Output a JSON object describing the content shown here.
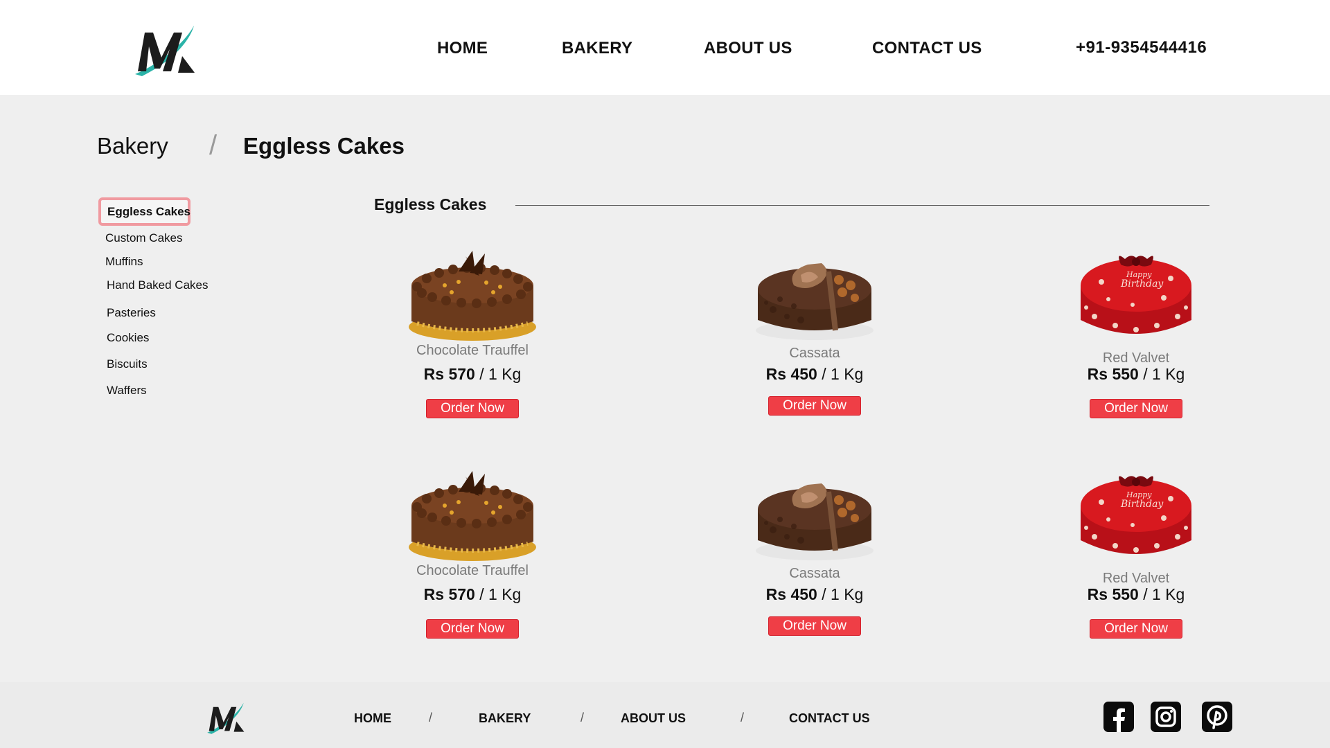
{
  "header": {
    "nav": [
      "HOME",
      "BAKERY",
      "ABOUT US",
      "CONTACT US"
    ],
    "phone": "+91-9354544416"
  },
  "breadcrumb": {
    "root": "Bakery",
    "separator": "/",
    "current": "Eggless Cakes"
  },
  "sidebar": {
    "items": [
      "Eggless Cakes",
      "Custom Cakes",
      "Muffins",
      "Hand Baked Cakes",
      "Pasteries",
      "Cookies",
      "Biscuits",
      "Waffers"
    ],
    "active_index": 0
  },
  "section": {
    "title": "Eggless Cakes"
  },
  "products": [
    {
      "name": "Chocolate Trauffel",
      "price": "Rs 570",
      "unit": " / 1 Kg",
      "button": "Order Now",
      "image": "chocolate-cake"
    },
    {
      "name": "Cassata",
      "price": "Rs 450",
      "unit": " / 1 Kg",
      "button": "Order Now",
      "image": "cassata-cake"
    },
    {
      "name": "Red Valvet",
      "price": "Rs 550",
      "unit": " / 1 Kg",
      "button": "Order Now",
      "image": "red-velvet-cake"
    },
    {
      "name": "Chocolate Trauffel",
      "price": "Rs 570",
      "unit": " / 1 Kg",
      "button": "Order Now",
      "image": "chocolate-cake"
    },
    {
      "name": "Cassata",
      "price": "Rs 450",
      "unit": " / 1 Kg",
      "button": "Order Now",
      "image": "cassata-cake"
    },
    {
      "name": "Red Valvet",
      "price": "Rs 550",
      "unit": " / 1 Kg",
      "button": "Order Now",
      "image": "red-velvet-cake"
    }
  ],
  "cake_text": {
    "line1": "Happy",
    "line2": "Birthday"
  },
  "footer": {
    "nav": [
      "HOME",
      "BAKERY",
      "ABOUT US",
      "CONTACT US"
    ],
    "separator": "/",
    "social": [
      "facebook-icon",
      "instagram-icon",
      "pinterest-icon"
    ]
  },
  "colors": {
    "accent_button": "#ef3e46",
    "active_border": "#f09aa0",
    "logo_teal": "#2bb3a8",
    "page_bg": "#efefef"
  }
}
